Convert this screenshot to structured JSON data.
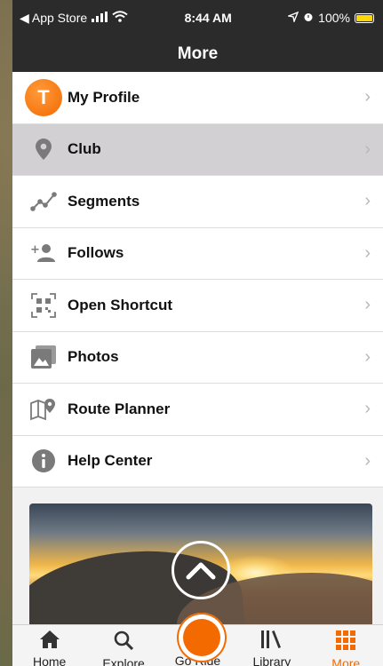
{
  "status": {
    "back_label": "◀ App Store",
    "time": "8:44 AM",
    "battery": "100%"
  },
  "header": {
    "title": "More"
  },
  "menu": {
    "items": [
      {
        "label": "My Profile",
        "icon": "avatar",
        "avatar_letter": "T"
      },
      {
        "label": "Club",
        "icon": "map-pin-icon",
        "selected": true
      },
      {
        "label": "Segments",
        "icon": "segments-icon"
      },
      {
        "label": "Follows",
        "icon": "add-person-icon"
      },
      {
        "label": "Open Shortcut",
        "icon": "qr-code-icon"
      },
      {
        "label": "Photos",
        "icon": "photos-icon"
      },
      {
        "label": "Route Planner",
        "icon": "map-pin-route-icon"
      },
      {
        "label": "Help Center",
        "icon": "info-icon"
      }
    ]
  },
  "tabbar": {
    "tabs": [
      {
        "label": "Home",
        "icon": "home-icon"
      },
      {
        "label": "Explore",
        "icon": "search-icon"
      },
      {
        "label": "Go Ride",
        "icon": "record-icon"
      },
      {
        "label": "Library",
        "icon": "library-icon"
      },
      {
        "label": "More",
        "icon": "grid-icon",
        "active": true
      }
    ]
  },
  "colors": {
    "accent": "#f26a00",
    "header": "#2b2b2b",
    "selected_row": "#d3d0d3"
  }
}
